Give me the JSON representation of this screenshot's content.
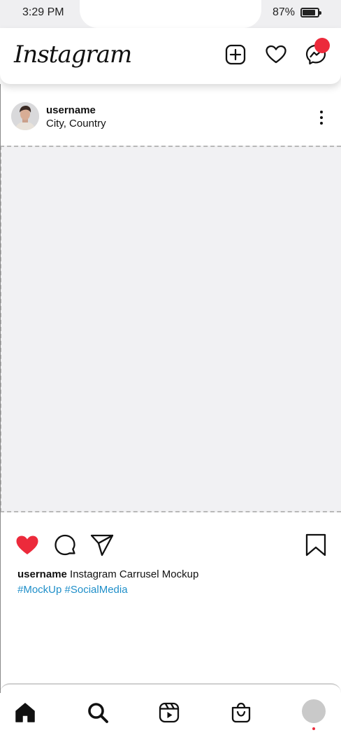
{
  "status_bar": {
    "time": "3:29 PM",
    "battery": "87%"
  },
  "header": {
    "logo": "Instagram"
  },
  "post": {
    "username": "username",
    "location": "City, Country",
    "caption_user": "username",
    "caption_text": "Instagram Carrusel Mockup",
    "hashtags": "#MockUp #SocialMedia"
  },
  "colors": {
    "like": "#ec2a3b",
    "hashtag": "#1f8fc9",
    "notification": "#ec2a3b",
    "image_placeholder": "#f1f1f3"
  },
  "icons": {
    "header": [
      "new-post-icon",
      "heart-icon",
      "messenger-icon"
    ],
    "actions": [
      "heart-filled-icon",
      "comment-icon",
      "share-icon",
      "bookmark-icon"
    ],
    "bottom_nav": [
      "home-icon",
      "search-icon",
      "reels-icon",
      "shop-icon",
      "profile-icon"
    ]
  }
}
